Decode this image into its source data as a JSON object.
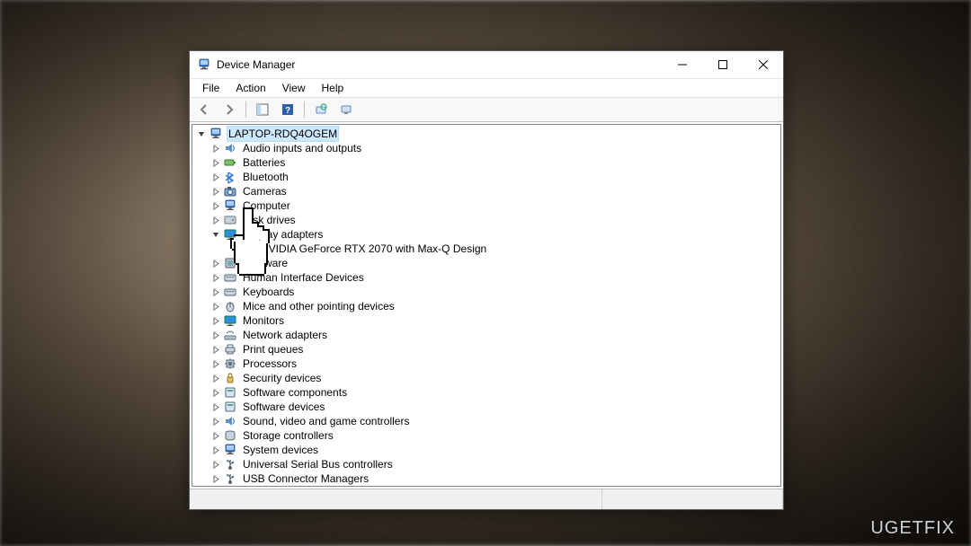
{
  "window": {
    "title": "Device Manager"
  },
  "menu": {
    "file": "File",
    "action": "Action",
    "view": "View",
    "help": "Help"
  },
  "tree": {
    "root": "LAPTOP-RDQ4OGEM",
    "items": [
      {
        "label": "Audio inputs and outputs",
        "icon": "audio",
        "expand": "collapsed"
      },
      {
        "label": "Batteries",
        "icon": "battery",
        "expand": "collapsed"
      },
      {
        "label": "Bluetooth",
        "icon": "bluetooth",
        "expand": "collapsed"
      },
      {
        "label": "Cameras",
        "icon": "camera",
        "expand": "collapsed"
      },
      {
        "label": "Computer",
        "icon": "computer",
        "expand": "collapsed"
      },
      {
        "label": "Disk drives",
        "icon": "disk",
        "expand": "collapsed"
      },
      {
        "label": "Display adapters",
        "icon": "display",
        "expand": "expanded",
        "children": [
          {
            "label": "NVIDIA GeForce RTX 2070 with Max-Q Design",
            "icon": "display"
          }
        ]
      },
      {
        "label": "Firmware",
        "icon": "firmware",
        "expand": "collapsed"
      },
      {
        "label": "Human Interface Devices",
        "icon": "hid",
        "expand": "collapsed",
        "obscured_prefix": "n Interface Devices"
      },
      {
        "label": "Keyboards",
        "icon": "keyboard",
        "expand": "collapsed",
        "obscured_prefix": "rds"
      },
      {
        "label": "Mice and other pointing devices",
        "icon": "mouse",
        "expand": "collapsed",
        "obscured_prefix": "d other pointing devices"
      },
      {
        "label": "Monitors",
        "icon": "monitor",
        "expand": "collapsed",
        "obscured_prefix": "rs"
      },
      {
        "label": "Network adapters",
        "icon": "network",
        "expand": "collapsed",
        "obscured_prefix": "work adapters"
      },
      {
        "label": "Print queues",
        "icon": "printer",
        "expand": "collapsed"
      },
      {
        "label": "Processors",
        "icon": "cpu",
        "expand": "collapsed"
      },
      {
        "label": "Security devices",
        "icon": "security",
        "expand": "collapsed"
      },
      {
        "label": "Software components",
        "icon": "software",
        "expand": "collapsed"
      },
      {
        "label": "Software devices",
        "icon": "software",
        "expand": "collapsed"
      },
      {
        "label": "Sound, video and game controllers",
        "icon": "sound",
        "expand": "collapsed"
      },
      {
        "label": "Storage controllers",
        "icon": "storage",
        "expand": "collapsed"
      },
      {
        "label": "System devices",
        "icon": "system",
        "expand": "collapsed"
      },
      {
        "label": "Universal Serial Bus controllers",
        "icon": "usb",
        "expand": "collapsed"
      },
      {
        "label": "USB Connector Managers",
        "icon": "usbc",
        "expand": "collapsed"
      }
    ]
  },
  "watermark": "UGETFIX"
}
